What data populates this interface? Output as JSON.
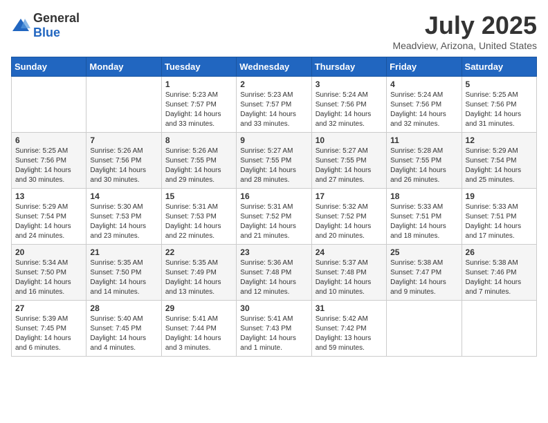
{
  "logo": {
    "general": "General",
    "blue": "Blue"
  },
  "title": "July 2025",
  "subtitle": "Meadview, Arizona, United States",
  "weekdays": [
    "Sunday",
    "Monday",
    "Tuesday",
    "Wednesday",
    "Thursday",
    "Friday",
    "Saturday"
  ],
  "weeks": [
    [
      {
        "day": "",
        "sunrise": "",
        "sunset": "",
        "daylight": ""
      },
      {
        "day": "",
        "sunrise": "",
        "sunset": "",
        "daylight": ""
      },
      {
        "day": "1",
        "sunrise": "Sunrise: 5:23 AM",
        "sunset": "Sunset: 7:57 PM",
        "daylight": "Daylight: 14 hours and 33 minutes."
      },
      {
        "day": "2",
        "sunrise": "Sunrise: 5:23 AM",
        "sunset": "Sunset: 7:57 PM",
        "daylight": "Daylight: 14 hours and 33 minutes."
      },
      {
        "day": "3",
        "sunrise": "Sunrise: 5:24 AM",
        "sunset": "Sunset: 7:56 PM",
        "daylight": "Daylight: 14 hours and 32 minutes."
      },
      {
        "day": "4",
        "sunrise": "Sunrise: 5:24 AM",
        "sunset": "Sunset: 7:56 PM",
        "daylight": "Daylight: 14 hours and 32 minutes."
      },
      {
        "day": "5",
        "sunrise": "Sunrise: 5:25 AM",
        "sunset": "Sunset: 7:56 PM",
        "daylight": "Daylight: 14 hours and 31 minutes."
      }
    ],
    [
      {
        "day": "6",
        "sunrise": "Sunrise: 5:25 AM",
        "sunset": "Sunset: 7:56 PM",
        "daylight": "Daylight: 14 hours and 30 minutes."
      },
      {
        "day": "7",
        "sunrise": "Sunrise: 5:26 AM",
        "sunset": "Sunset: 7:56 PM",
        "daylight": "Daylight: 14 hours and 30 minutes."
      },
      {
        "day": "8",
        "sunrise": "Sunrise: 5:26 AM",
        "sunset": "Sunset: 7:55 PM",
        "daylight": "Daylight: 14 hours and 29 minutes."
      },
      {
        "day": "9",
        "sunrise": "Sunrise: 5:27 AM",
        "sunset": "Sunset: 7:55 PM",
        "daylight": "Daylight: 14 hours and 28 minutes."
      },
      {
        "day": "10",
        "sunrise": "Sunrise: 5:27 AM",
        "sunset": "Sunset: 7:55 PM",
        "daylight": "Daylight: 14 hours and 27 minutes."
      },
      {
        "day": "11",
        "sunrise": "Sunrise: 5:28 AM",
        "sunset": "Sunset: 7:55 PM",
        "daylight": "Daylight: 14 hours and 26 minutes."
      },
      {
        "day": "12",
        "sunrise": "Sunrise: 5:29 AM",
        "sunset": "Sunset: 7:54 PM",
        "daylight": "Daylight: 14 hours and 25 minutes."
      }
    ],
    [
      {
        "day": "13",
        "sunrise": "Sunrise: 5:29 AM",
        "sunset": "Sunset: 7:54 PM",
        "daylight": "Daylight: 14 hours and 24 minutes."
      },
      {
        "day": "14",
        "sunrise": "Sunrise: 5:30 AM",
        "sunset": "Sunset: 7:53 PM",
        "daylight": "Daylight: 14 hours and 23 minutes."
      },
      {
        "day": "15",
        "sunrise": "Sunrise: 5:31 AM",
        "sunset": "Sunset: 7:53 PM",
        "daylight": "Daylight: 14 hours and 22 minutes."
      },
      {
        "day": "16",
        "sunrise": "Sunrise: 5:31 AM",
        "sunset": "Sunset: 7:52 PM",
        "daylight": "Daylight: 14 hours and 21 minutes."
      },
      {
        "day": "17",
        "sunrise": "Sunrise: 5:32 AM",
        "sunset": "Sunset: 7:52 PM",
        "daylight": "Daylight: 14 hours and 20 minutes."
      },
      {
        "day": "18",
        "sunrise": "Sunrise: 5:33 AM",
        "sunset": "Sunset: 7:51 PM",
        "daylight": "Daylight: 14 hours and 18 minutes."
      },
      {
        "day": "19",
        "sunrise": "Sunrise: 5:33 AM",
        "sunset": "Sunset: 7:51 PM",
        "daylight": "Daylight: 14 hours and 17 minutes."
      }
    ],
    [
      {
        "day": "20",
        "sunrise": "Sunrise: 5:34 AM",
        "sunset": "Sunset: 7:50 PM",
        "daylight": "Daylight: 14 hours and 16 minutes."
      },
      {
        "day": "21",
        "sunrise": "Sunrise: 5:35 AM",
        "sunset": "Sunset: 7:50 PM",
        "daylight": "Daylight: 14 hours and 14 minutes."
      },
      {
        "day": "22",
        "sunrise": "Sunrise: 5:35 AM",
        "sunset": "Sunset: 7:49 PM",
        "daylight": "Daylight: 14 hours and 13 minutes."
      },
      {
        "day": "23",
        "sunrise": "Sunrise: 5:36 AM",
        "sunset": "Sunset: 7:48 PM",
        "daylight": "Daylight: 14 hours and 12 minutes."
      },
      {
        "day": "24",
        "sunrise": "Sunrise: 5:37 AM",
        "sunset": "Sunset: 7:48 PM",
        "daylight": "Daylight: 14 hours and 10 minutes."
      },
      {
        "day": "25",
        "sunrise": "Sunrise: 5:38 AM",
        "sunset": "Sunset: 7:47 PM",
        "daylight": "Daylight: 14 hours and 9 minutes."
      },
      {
        "day": "26",
        "sunrise": "Sunrise: 5:38 AM",
        "sunset": "Sunset: 7:46 PM",
        "daylight": "Daylight: 14 hours and 7 minutes."
      }
    ],
    [
      {
        "day": "27",
        "sunrise": "Sunrise: 5:39 AM",
        "sunset": "Sunset: 7:45 PM",
        "daylight": "Daylight: 14 hours and 6 minutes."
      },
      {
        "day": "28",
        "sunrise": "Sunrise: 5:40 AM",
        "sunset": "Sunset: 7:45 PM",
        "daylight": "Daylight: 14 hours and 4 minutes."
      },
      {
        "day": "29",
        "sunrise": "Sunrise: 5:41 AM",
        "sunset": "Sunset: 7:44 PM",
        "daylight": "Daylight: 14 hours and 3 minutes."
      },
      {
        "day": "30",
        "sunrise": "Sunrise: 5:41 AM",
        "sunset": "Sunset: 7:43 PM",
        "daylight": "Daylight: 14 hours and 1 minute."
      },
      {
        "day": "31",
        "sunrise": "Sunrise: 5:42 AM",
        "sunset": "Sunset: 7:42 PM",
        "daylight": "Daylight: 13 hours and 59 minutes."
      },
      {
        "day": "",
        "sunrise": "",
        "sunset": "",
        "daylight": ""
      },
      {
        "day": "",
        "sunrise": "",
        "sunset": "",
        "daylight": ""
      }
    ]
  ]
}
